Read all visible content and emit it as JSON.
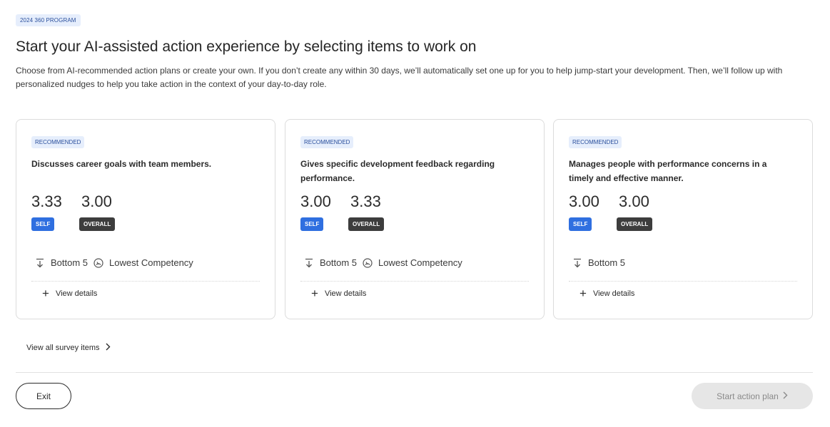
{
  "header": {
    "program_badge": "2024 360 PROGRAM",
    "title": "Start your AI-assisted action experience by selecting items to work on",
    "description": "Choose from AI-recommended action plans or create your own. If you don’t create any within 30 days, we’ll automatically set one up for you to help jump-start your development. Then, we’ll follow up with personalized nudges to help you take action in the context of your day-to-day role."
  },
  "cards": [
    {
      "badge": "RECOMMENDED",
      "title": "Discusses career goals with team members.",
      "self_score": "3.33",
      "overall_score": "3.00",
      "self_label": "SELF",
      "overall_label": "OVERALL",
      "bottom_label": "Bottom 5",
      "competency_label": "Lowest Competency",
      "view_details": "View details"
    },
    {
      "badge": "RECOMMENDED",
      "title": "Gives specific development feedback regarding performance.",
      "self_score": "3.00",
      "overall_score": "3.33",
      "self_label": "SELF",
      "overall_label": "OVERALL",
      "bottom_label": "Bottom 5",
      "competency_label": "Lowest Competency",
      "view_details": "View details"
    },
    {
      "badge": "RECOMMENDED",
      "title": "Manages people with performance concerns in a timely and effective manner.",
      "self_score": "3.00",
      "overall_score": "3.00",
      "self_label": "SELF",
      "overall_label": "OVERALL",
      "bottom_label": "Bottom 5",
      "view_details": "View details"
    }
  ],
  "view_all": "View all survey items",
  "footer": {
    "exit_label": "Exit",
    "start_label": "Start action plan"
  },
  "colors": {
    "self_tag": "#2f6fe0",
    "overall_tag": "#3d3d3d",
    "badge_bg": "#e6eefc",
    "disabled_button": "#e6e6e6"
  }
}
